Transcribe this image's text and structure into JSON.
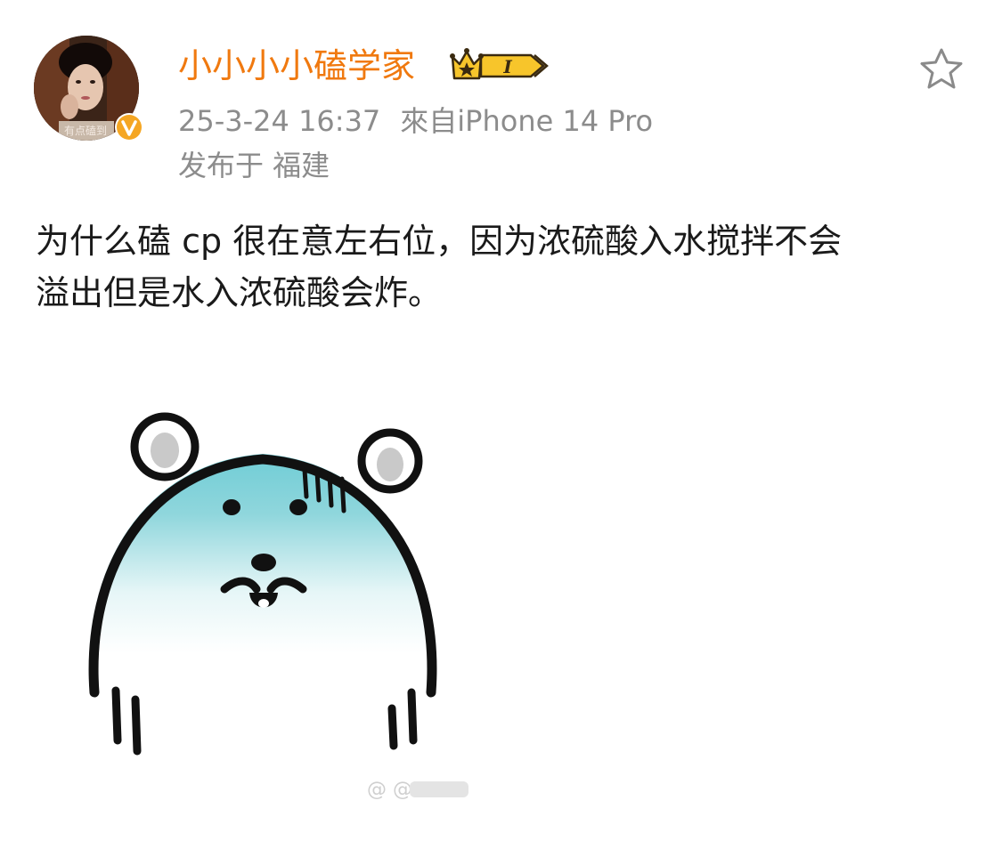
{
  "author": {
    "name": "小小小小磕学家",
    "avatar_caption": "有点磕到",
    "verified_icon": "verified-v-icon",
    "badge_icon": "crown-level-badge-icon",
    "badge_level": "I",
    "name_color": "#f0790f"
  },
  "post_meta": {
    "date": "25-3-24 16:37",
    "source": "來自iPhone 14 Pro",
    "location": "发布于 福建"
  },
  "actions": {
    "favorite_icon": "star-outline-icon"
  },
  "post": {
    "text_line1": "为什么磕 cp 很在意左右位，因为浓硫酸入水搅拌不会",
    "text_line2": "溢出但是水入浓硫酸会炸。",
    "image_icon": "bear-sticker-image"
  }
}
